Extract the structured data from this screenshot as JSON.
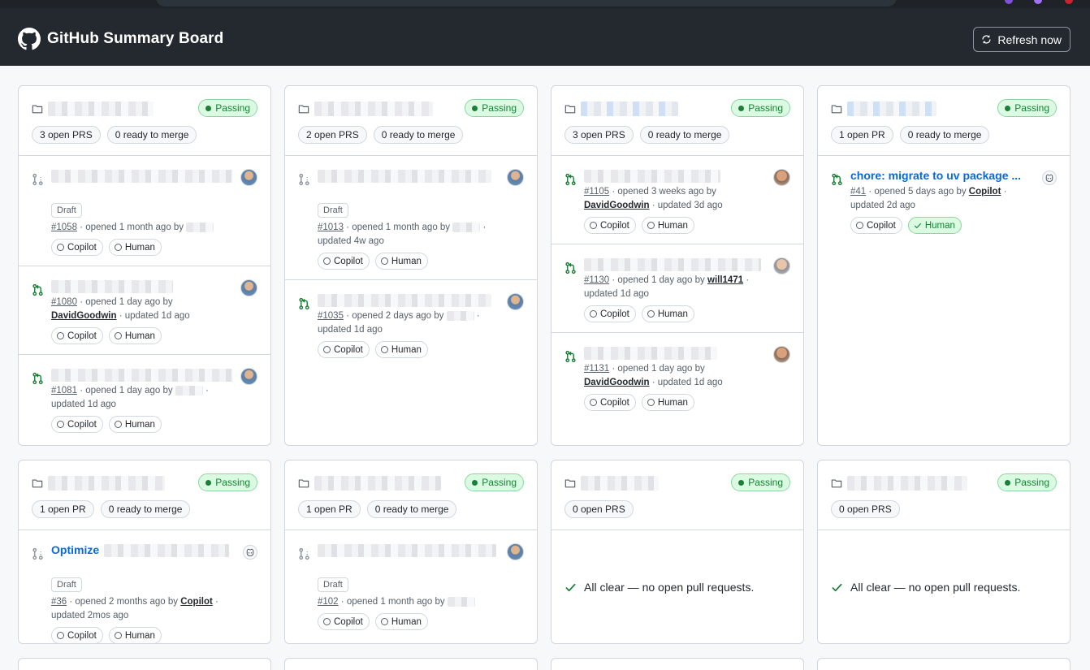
{
  "header": {
    "title": "GitHub Summary Board",
    "refresh_label": "Refresh now"
  },
  "labels": {
    "passing": "Passing",
    "draft": "Draft",
    "copilot": "Copilot",
    "human": "Human",
    "ready_suffix": "ready to merge",
    "empty_message": "All clear — no open pull requests."
  },
  "colors": {
    "topbar": "#24292f",
    "link": "#0969da",
    "success": "#1a7f37",
    "success_bg": "#dafbe1"
  },
  "repos": [
    {
      "open": "3 open PRS",
      "ready": "0 ready to merge",
      "prs": [
        {
          "number": "#1058",
          "draft": true,
          "icon": "draft",
          "meta": "· opened 1 month ago by",
          "author": "",
          "updated": "",
          "avatar": "photo"
        },
        {
          "number": "#1080",
          "draft": false,
          "icon": "open",
          "meta": "· opened 1 day ago by",
          "author": "DavidGoodwin",
          "updated": "· updated 1d ago",
          "avatar": "photo"
        },
        {
          "number": "#1081",
          "draft": false,
          "icon": "open",
          "meta": "· opened 1 day ago by",
          "author": "",
          "updated": "updated 1d ago",
          "avatar": "photo"
        }
      ]
    },
    {
      "open": "2 open PRS",
      "ready": "0 ready to merge",
      "prs": [
        {
          "number": "#1013",
          "draft": true,
          "icon": "draft",
          "meta": "· opened 1 month ago by",
          "author": "",
          "updated": "updated 4w ago",
          "avatar": "photo"
        },
        {
          "number": "#1035",
          "draft": false,
          "icon": "open",
          "meta": "· opened 2 days ago by",
          "author": "",
          "updated": "updated 1d ago",
          "avatar": "photo"
        }
      ]
    },
    {
      "open": "3 open PRS",
      "ready": "0 ready to merge",
      "prs": [
        {
          "number": "#1105",
          "draft": false,
          "icon": "open",
          "meta": "· opened 3 weeks ago by",
          "author": "DavidGoodwin",
          "updated": "· updated 3d ago",
          "avatar": "photo"
        },
        {
          "number": "#1130",
          "draft": false,
          "icon": "open",
          "meta": "· opened 1 day ago by",
          "author": "will1471",
          "updated": "updated 1d ago",
          "avatar": "photo"
        },
        {
          "number": "#1131",
          "draft": false,
          "icon": "open",
          "meta": "· opened 1 day ago by",
          "author": "DavidGoodwin",
          "updated": "· updated 1d ago",
          "avatar": "photo"
        }
      ]
    },
    {
      "open": "1 open PR",
      "ready": "0 ready to merge",
      "prs": [
        {
          "title": "chore: migrate to uv package ...",
          "number": "#41",
          "draft": false,
          "icon": "open",
          "meta": "· opened 5 days ago by",
          "author": "Copilot",
          "updated": "updated 2d ago",
          "avatar": "copilot",
          "human_ok": true
        }
      ]
    },
    {
      "open": "1 open PR",
      "ready": "0 ready to merge",
      "prs": [
        {
          "title": "Optimize",
          "number": "#36",
          "draft": true,
          "icon": "draft",
          "meta": "· opened 2 months ago by",
          "author": "Copilot",
          "updated": "updated 2mos ago",
          "avatar": "copilot"
        }
      ]
    },
    {
      "open": "1 open PR",
      "ready": "0 ready to merge",
      "prs": [
        {
          "number": "#102",
          "draft": true,
          "icon": "draft",
          "meta": "· opened 1 month ago by",
          "author": "",
          "updated": "",
          "avatar": "photo"
        }
      ]
    },
    {
      "open": "0 open PRS",
      "ready": "",
      "prs": []
    },
    {
      "open": "0 open PRS",
      "ready": "",
      "prs": []
    }
  ]
}
